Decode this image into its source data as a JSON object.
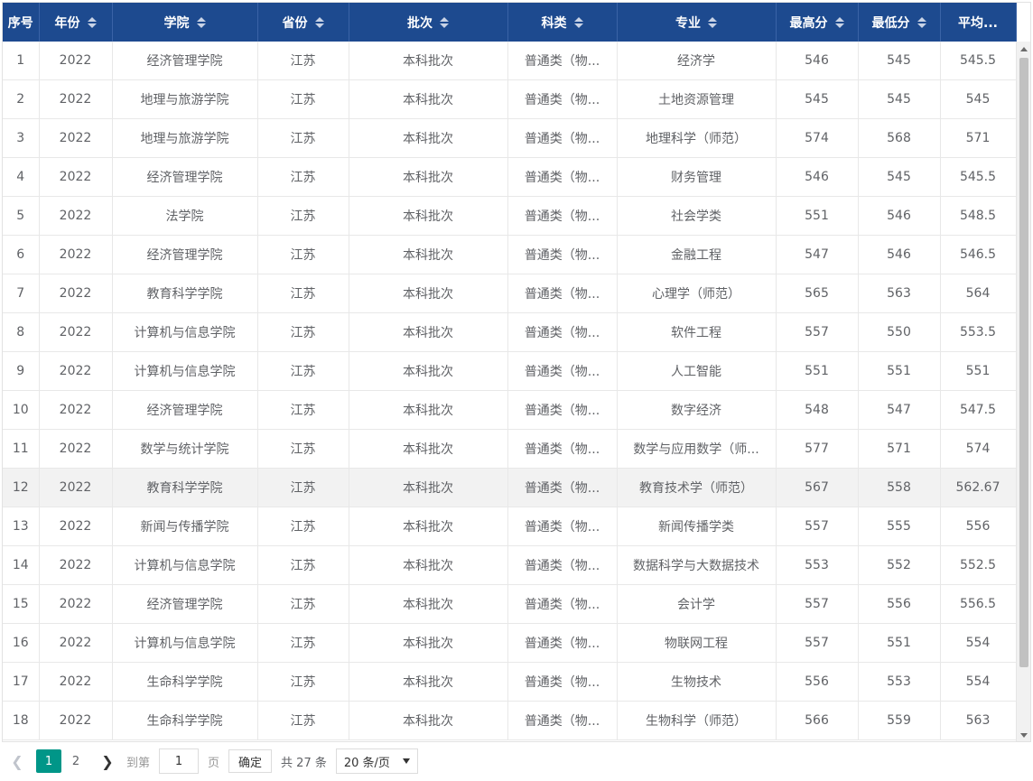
{
  "columns": [
    {
      "label": "序号",
      "sortable": false
    },
    {
      "label": "年份",
      "sortable": true
    },
    {
      "label": "学院",
      "sortable": true
    },
    {
      "label": "省份",
      "sortable": true
    },
    {
      "label": "批次",
      "sortable": true
    },
    {
      "label": "科类",
      "sortable": true
    },
    {
      "label": "专业",
      "sortable": true
    },
    {
      "label": "最高分",
      "sortable": true
    },
    {
      "label": "最低分",
      "sortable": true
    },
    {
      "label": "平均...",
      "sortable": false
    }
  ],
  "rows": [
    [
      "1",
      "2022",
      "经济管理学院",
      "江苏",
      "本科批次",
      "普通类（物...",
      "经济学",
      "546",
      "545",
      "545.5"
    ],
    [
      "2",
      "2022",
      "地理与旅游学院",
      "江苏",
      "本科批次",
      "普通类（物...",
      "土地资源管理",
      "545",
      "545",
      "545"
    ],
    [
      "3",
      "2022",
      "地理与旅游学院",
      "江苏",
      "本科批次",
      "普通类（物...",
      "地理科学（师范）",
      "574",
      "568",
      "571"
    ],
    [
      "4",
      "2022",
      "经济管理学院",
      "江苏",
      "本科批次",
      "普通类（物...",
      "财务管理",
      "546",
      "545",
      "545.5"
    ],
    [
      "5",
      "2022",
      "法学院",
      "江苏",
      "本科批次",
      "普通类（物...",
      "社会学类",
      "551",
      "546",
      "548.5"
    ],
    [
      "6",
      "2022",
      "经济管理学院",
      "江苏",
      "本科批次",
      "普通类（物...",
      "金融工程",
      "547",
      "546",
      "546.5"
    ],
    [
      "7",
      "2022",
      "教育科学学院",
      "江苏",
      "本科批次",
      "普通类（物...",
      "心理学（师范）",
      "565",
      "563",
      "564"
    ],
    [
      "8",
      "2022",
      "计算机与信息学院",
      "江苏",
      "本科批次",
      "普通类（物...",
      "软件工程",
      "557",
      "550",
      "553.5"
    ],
    [
      "9",
      "2022",
      "计算机与信息学院",
      "江苏",
      "本科批次",
      "普通类（物...",
      "人工智能",
      "551",
      "551",
      "551"
    ],
    [
      "10",
      "2022",
      "经济管理学院",
      "江苏",
      "本科批次",
      "普通类（物...",
      "数字经济",
      "548",
      "547",
      "547.5"
    ],
    [
      "11",
      "2022",
      "数学与统计学院",
      "江苏",
      "本科批次",
      "普通类（物...",
      "数学与应用数学（师...",
      "577",
      "571",
      "574"
    ],
    [
      "12",
      "2022",
      "教育科学学院",
      "江苏",
      "本科批次",
      "普通类（物...",
      "教育技术学（师范）",
      "567",
      "558",
      "562.67"
    ],
    [
      "13",
      "2022",
      "新闻与传播学院",
      "江苏",
      "本科批次",
      "普通类（物...",
      "新闻传播学类",
      "557",
      "555",
      "556"
    ],
    [
      "14",
      "2022",
      "计算机与信息学院",
      "江苏",
      "本科批次",
      "普通类（物...",
      "数据科学与大数据技术",
      "553",
      "552",
      "552.5"
    ],
    [
      "15",
      "2022",
      "经济管理学院",
      "江苏",
      "本科批次",
      "普通类（物...",
      "会计学",
      "557",
      "556",
      "556.5"
    ],
    [
      "16",
      "2022",
      "计算机与信息学院",
      "江苏",
      "本科批次",
      "普通类（物...",
      "物联网工程",
      "557",
      "551",
      "554"
    ],
    [
      "17",
      "2022",
      "生命科学学院",
      "江苏",
      "本科批次",
      "普通类（物...",
      "生物技术",
      "556",
      "553",
      "554"
    ],
    [
      "18",
      "2022",
      "生命科学学院",
      "江苏",
      "本科批次",
      "普通类（物...",
      "生物科学（师范）",
      "566",
      "559",
      "563"
    ]
  ],
  "highlighted_row": "12",
  "pager": {
    "prev_icon": "chevron-left-icon",
    "next_icon": "chevron-right-icon",
    "pages": [
      "1",
      "2"
    ],
    "current": "1",
    "goto_label": "到第",
    "goto_value": "1",
    "page_unit": "页",
    "confirm_label": "确定",
    "total_label": "共 27 条",
    "page_size_label": "20 条/页"
  },
  "colors": {
    "header_bg": "#1d4a8f",
    "active_page": "#009688",
    "row_highlight": "#f2f2f2"
  }
}
